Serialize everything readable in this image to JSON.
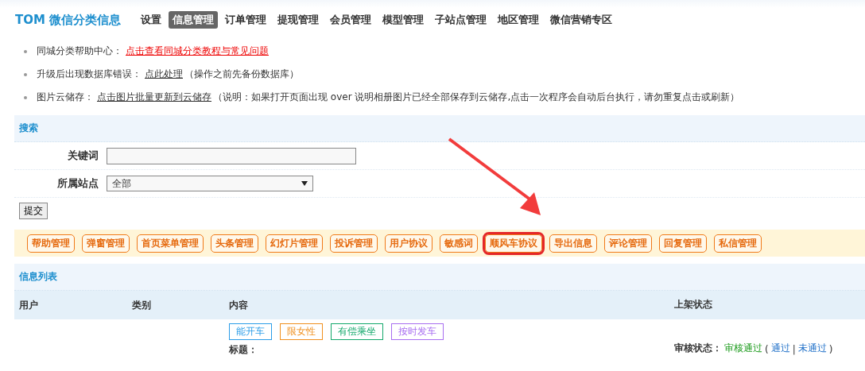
{
  "brand": "TOM 微信分类信息",
  "nav": [
    {
      "label": "设置",
      "selected": false
    },
    {
      "label": "信息管理",
      "selected": true
    },
    {
      "label": "订单管理",
      "selected": false
    },
    {
      "label": "提现管理",
      "selected": false
    },
    {
      "label": "会员管理",
      "selected": false
    },
    {
      "label": "模型管理",
      "selected": false
    },
    {
      "label": "子站点管理",
      "selected": false
    },
    {
      "label": "地区管理",
      "selected": false
    },
    {
      "label": "微信营销专区",
      "selected": false
    }
  ],
  "notices": [
    {
      "label": "同城分类帮助中心：",
      "link": "点击查看同城分类教程与常见问题",
      "link_red": true
    },
    {
      "label": "升级后出现数据库错误：",
      "link": "点此处理",
      "link_red": false,
      "note": "（操作之前先备份数据库）"
    },
    {
      "label": "图片云储存：",
      "link": "点击图片批量更新到云储存",
      "link_red": false,
      "note": " （说明：如果打开页面出现 over 说明相册图片已经全部保存到云储存,点击一次程序会自动后台执行，请勿重复点击或刷新）"
    }
  ],
  "search": {
    "title": "搜索",
    "keyword_label": "关键词",
    "site_label": "所属站点",
    "site_value": "全部",
    "submit": "提交"
  },
  "tool_buttons": [
    {
      "label": "帮助管理",
      "highlighted": false
    },
    {
      "label": "弹窗管理",
      "highlighted": false
    },
    {
      "label": "首页菜单管理",
      "highlighted": false
    },
    {
      "label": "头条管理",
      "highlighted": false
    },
    {
      "label": "幻灯片管理",
      "highlighted": false
    },
    {
      "label": "投诉管理",
      "highlighted": false
    },
    {
      "label": "用户协议",
      "highlighted": false
    },
    {
      "label": "敏感词",
      "highlighted": false
    },
    {
      "label": "顺风车协议",
      "highlighted": true
    },
    {
      "label": "导出信息",
      "highlighted": false
    },
    {
      "label": "评论管理",
      "highlighted": false
    },
    {
      "label": "回复管理",
      "highlighted": false
    },
    {
      "label": "私信管理",
      "highlighted": false
    }
  ],
  "list": {
    "title": "信息列表",
    "columns": [
      "用户",
      "类别",
      "内容",
      "上架状态"
    ],
    "rows": [
      {
        "tags": [
          {
            "label": "能开车",
            "color": "#2b9de8"
          },
          {
            "label": "限女性",
            "color": "#f0901e"
          },
          {
            "label": "有偿乘坐",
            "color": "#13a86b"
          },
          {
            "label": "按时发车",
            "color": "#a86ef0"
          }
        ],
        "title_label": "标题：",
        "status_label": "审核状态：",
        "status": "审核通过",
        "open": "(",
        "actions": [
          "通过",
          "未通过"
        ],
        "separator": "|",
        "close": ")"
      }
    ]
  }
}
